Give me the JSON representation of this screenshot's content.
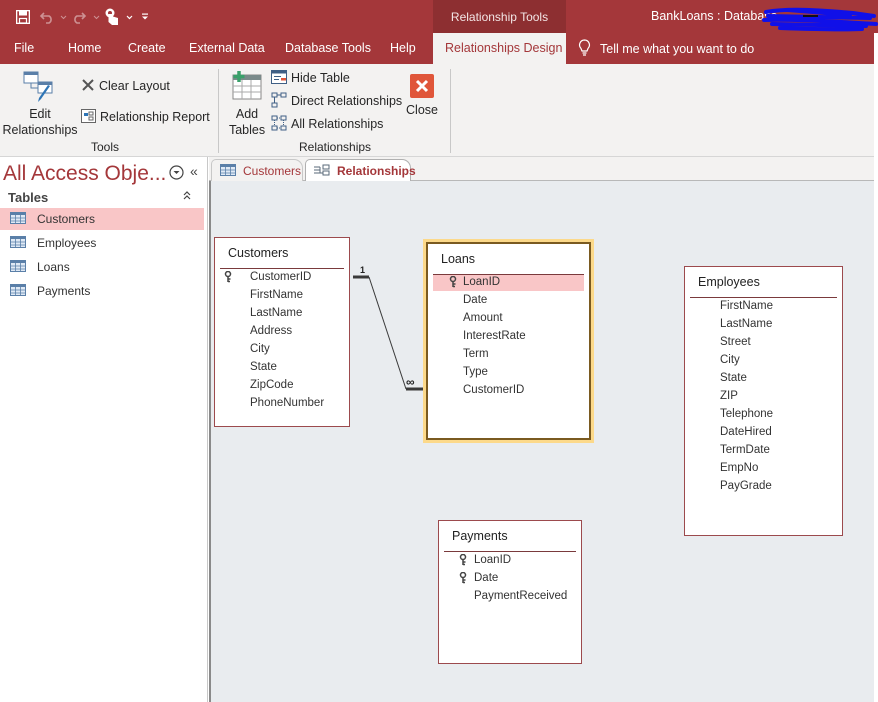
{
  "title_bar": {
    "context_tab": "Relationship Tools",
    "app_title": "BankLoans : Database",
    "qat": {
      "save_icon": "save-icon",
      "undo_icon": "undo-icon",
      "redo_icon": "redo-icon",
      "touch_mode_icon": "touch-mouse-mode-icon",
      "customize_icon": "customize-qat-icon"
    }
  },
  "menu": {
    "tabs": [
      {
        "label": "File",
        "active": false
      },
      {
        "label": "Home",
        "active": false
      },
      {
        "label": "Create",
        "active": false
      },
      {
        "label": "External Data",
        "active": false
      },
      {
        "label": "Database Tools",
        "active": false
      },
      {
        "label": "Help",
        "active": false
      },
      {
        "label": "Relationships Design",
        "active": true
      }
    ],
    "tell_me": "Tell me what you want to do"
  },
  "ribbon": {
    "groups": [
      {
        "label": "Tools",
        "edit_relationships": "Edit Relationships",
        "edit_relationships_line1": "Edit",
        "edit_relationships_line2": "Relationships",
        "clear_layout": "Clear Layout",
        "relationship_report": "Relationship Report"
      },
      {
        "label": "Relationships",
        "add_tables_line1": "Add",
        "add_tables_line2": "Tables",
        "hide_table": "Hide Table",
        "direct_relationships": "Direct Relationships",
        "all_relationships": "All Relationships",
        "close": "Close"
      }
    ]
  },
  "nav_pane": {
    "title": "All Access Obje...",
    "section": "Tables",
    "items": [
      {
        "label": "Customers",
        "selected": true
      },
      {
        "label": "Employees",
        "selected": false
      },
      {
        "label": "Loans",
        "selected": false
      },
      {
        "label": "Payments",
        "selected": false
      }
    ]
  },
  "doc_tabs": [
    {
      "label": "Customers",
      "active": false
    },
    {
      "label": "Relationships",
      "active": true
    }
  ],
  "diagram": {
    "tables": [
      {
        "name": "Customers",
        "selected": false,
        "fields": [
          {
            "name": "CustomerID",
            "key": true
          },
          {
            "name": "FirstName",
            "key": false
          },
          {
            "name": "LastName",
            "key": false
          },
          {
            "name": "Address",
            "key": false
          },
          {
            "name": "City",
            "key": false
          },
          {
            "name": "State",
            "key": false
          },
          {
            "name": "ZipCode",
            "key": false
          },
          {
            "name": "PhoneNumber",
            "key": false
          }
        ]
      },
      {
        "name": "Loans",
        "selected": true,
        "fields": [
          {
            "name": "LoanID",
            "key": true,
            "highlighted": true
          },
          {
            "name": "Date",
            "key": false
          },
          {
            "name": "Amount",
            "key": false
          },
          {
            "name": "InterestRate",
            "key": false
          },
          {
            "name": "Term",
            "key": false
          },
          {
            "name": "Type",
            "key": false
          },
          {
            "name": "CustomerID",
            "key": false
          }
        ]
      },
      {
        "name": "Employees",
        "selected": false,
        "fields": [
          {
            "name": "FirstName",
            "key": false
          },
          {
            "name": "LastName",
            "key": false
          },
          {
            "name": "Street",
            "key": false
          },
          {
            "name": "City",
            "key": false
          },
          {
            "name": "State",
            "key": false
          },
          {
            "name": "ZIP",
            "key": false
          },
          {
            "name": "Telephone",
            "key": false
          },
          {
            "name": "DateHired",
            "key": false
          },
          {
            "name": "TermDate",
            "key": false
          },
          {
            "name": "EmpNo",
            "key": false
          },
          {
            "name": "PayGrade",
            "key": false
          }
        ]
      },
      {
        "name": "Payments",
        "selected": false,
        "fields": [
          {
            "name": "LoanID",
            "key": true
          },
          {
            "name": "Date",
            "key": true
          },
          {
            "name": "PaymentReceived",
            "key": false
          }
        ]
      }
    ],
    "relationships": [
      {
        "from_table": "Customers",
        "from_field": "CustomerID",
        "to_table": "Loans",
        "to_field": "CustomerID",
        "one_label": "1",
        "many_label": "∞"
      }
    ]
  },
  "colors": {
    "accent": "#a4373a",
    "context_tab": "#8d2f31",
    "selection_pink": "#f9c6c7",
    "canvas": "#e9ecef",
    "selected_table_glow": "#fcd98a",
    "close_button": "#e0563a"
  }
}
